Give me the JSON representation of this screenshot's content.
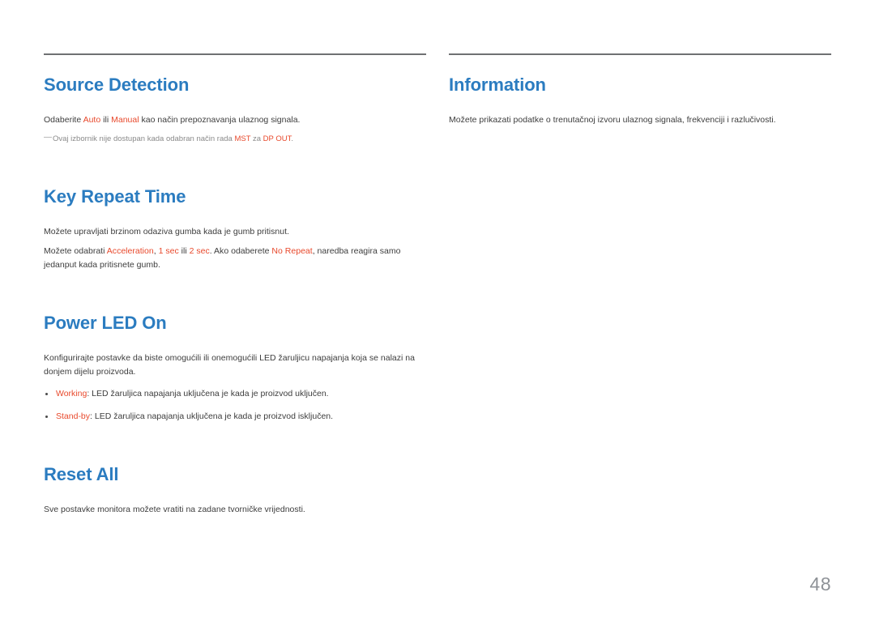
{
  "document": {
    "page_number": "48",
    "language": "hr",
    "accent_color": "#e8492c",
    "heading_color": "#2b7cc0",
    "body_color": "#3d3d3d",
    "note_color": "#8a8a8a",
    "rule_color": "#6f7173",
    "page_number_color": "#8e9297"
  },
  "left_column": {
    "sections": [
      {
        "title": "Source Detection",
        "paragraph_1_part_1": "Odaberite ",
        "paragraph_1_accent_1": "Auto",
        "paragraph_1_part_2": " ili ",
        "paragraph_1_accent_2": "Manual",
        "paragraph_1_part_3": " kao način prepoznavanja ulaznog signala.",
        "note_dash": "―",
        "note_part_1": "Ovaj izbornik nije dostupan kada odabran način rada ",
        "note_accent_1": "MST",
        "note_part_2": " za ",
        "note_accent_2": "DP OUT",
        "note_part_3": "."
      },
      {
        "title": "Key Repeat Time",
        "paragraph_1": "Možete upravljati brzinom odaziva gumba kada je gumb pritisnut.",
        "paragraph_2_part_1": "Možete odabrati ",
        "paragraph_2_accent_1": "Acceleration",
        "paragraph_2_part_2": ", ",
        "paragraph_2_accent_2": "1 sec",
        "paragraph_2_part_3": " ili ",
        "paragraph_2_accent_3": "2 sec",
        "paragraph_2_part_4": ". Ako odaberete ",
        "paragraph_2_accent_4": "No Repeat",
        "paragraph_2_part_5": ", naredba reagira samo jedanput kada pritisnete gumb."
      },
      {
        "title": "Power LED On",
        "paragraph_1": "Konfigurirajte postavke da biste omogućili ili onemogućili LED žaruljicu napajanja koja se nalazi na donjem dijelu proizvoda.",
        "bullets": [
          {
            "label": "Working",
            "text": ": LED žaruljica napajanja uključena je kada je proizvod uključen."
          },
          {
            "label": "Stand-by",
            "text": ": LED žaruljica napajanja uključena je kada je proizvod isključen."
          }
        ]
      },
      {
        "title": "Reset All",
        "paragraph_1": "Sve postavke monitora možete vratiti na zadane tvorničke vrijednosti."
      }
    ]
  },
  "right_column": {
    "sections": [
      {
        "title": "Information",
        "paragraph_1": "Možete prikazati podatke o trenutačnoj izvoru ulaznog signala, frekvenciji i razlučivosti."
      }
    ]
  }
}
